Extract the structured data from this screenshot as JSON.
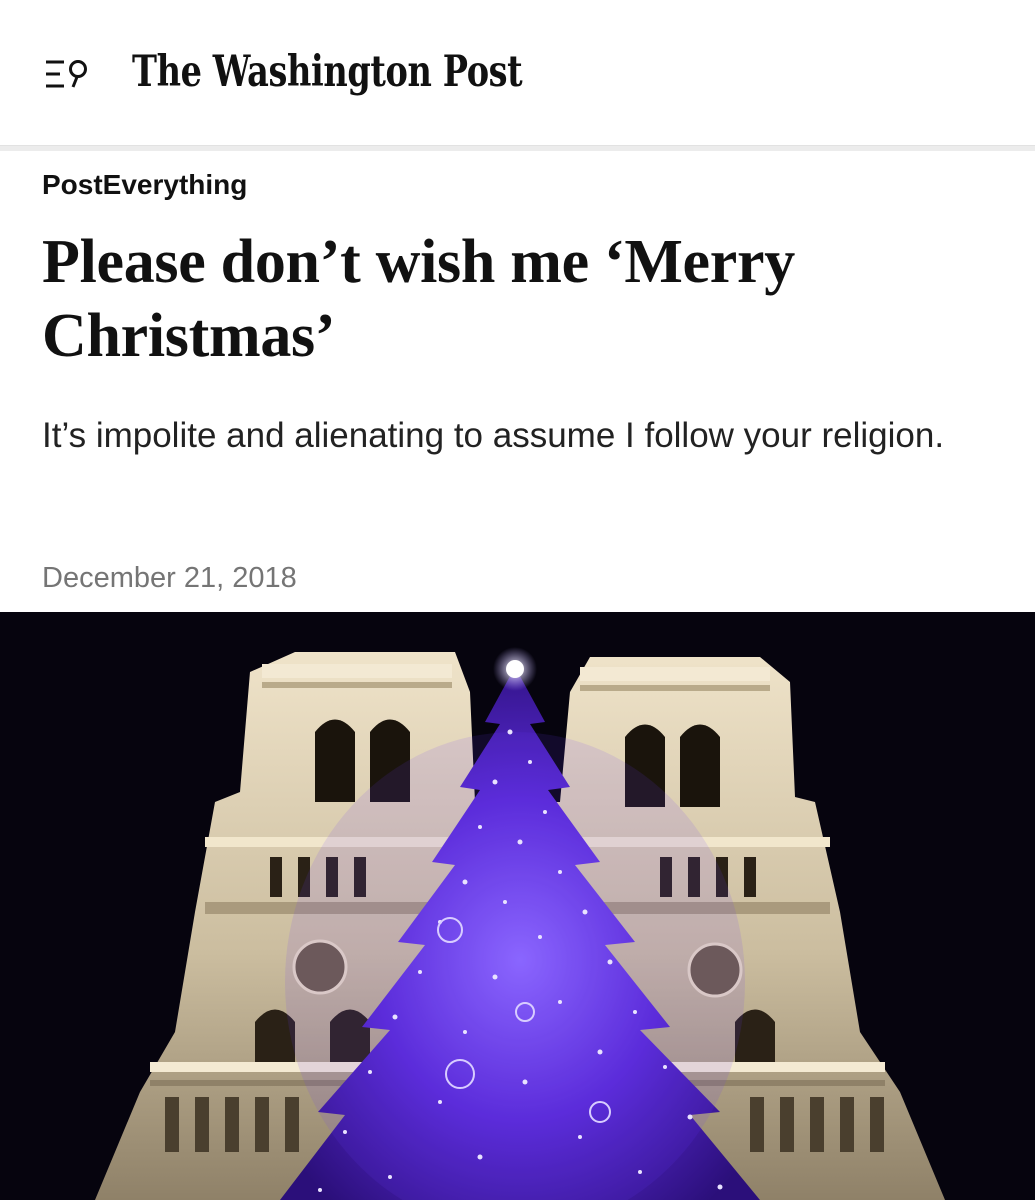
{
  "header": {
    "menu_search_icon": "menu-search-icon",
    "masthead": "The Washington Post"
  },
  "article": {
    "kicker": "PostEverything",
    "headline": "Please don’t wish me ‘Merry Christmas’",
    "dek": "It’s impolite and alienating to assume I follow your religion.",
    "date": "December 21, 2018"
  },
  "colors": {
    "text": "#111111",
    "date_gray": "#757575",
    "tree_purple": "#5a2bd6",
    "night_sky": "#06040e",
    "stone_lit": "#d9cdb4"
  }
}
